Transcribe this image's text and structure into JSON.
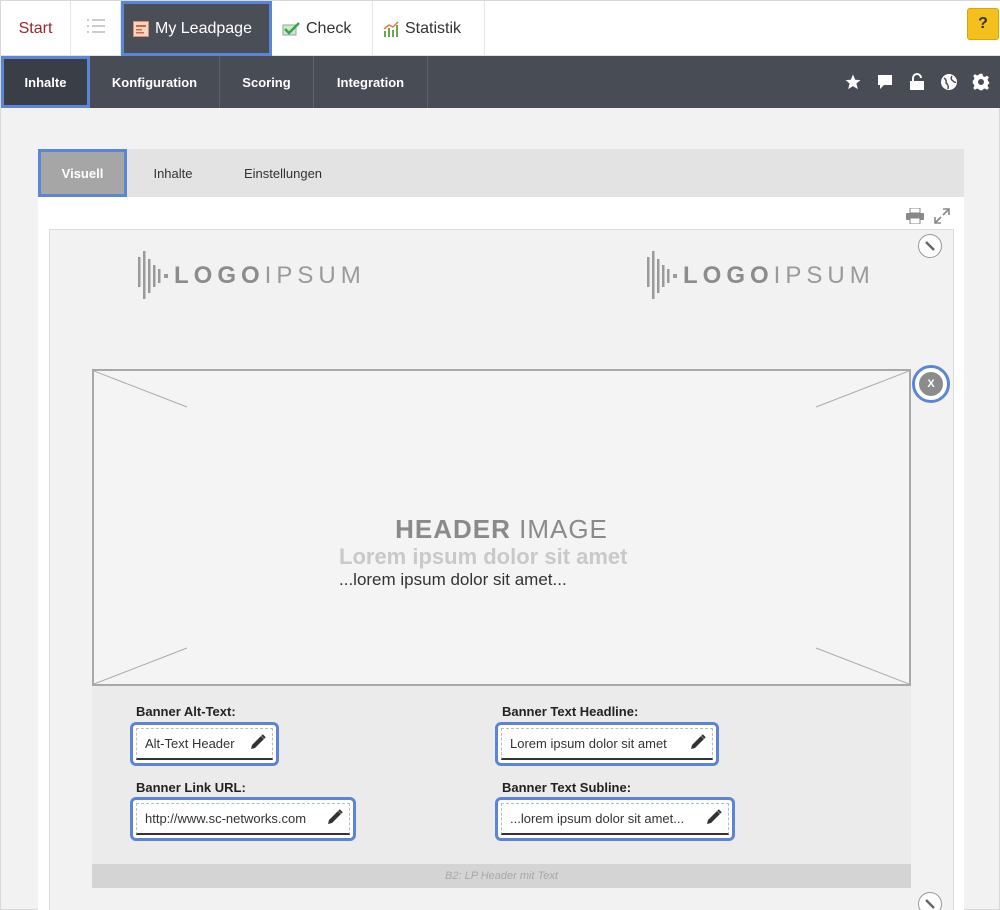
{
  "top_tabs": {
    "start": "Start",
    "leadpage": "My Leadpage",
    "check": "Check",
    "statistik": "Statistik",
    "help": "?"
  },
  "nav": {
    "items": [
      "Inhalte",
      "Konfiguration",
      "Scoring",
      "Integration"
    ],
    "icons": [
      "star-icon",
      "comment-icon",
      "unlock-icon",
      "globe-icon",
      "gear-icon"
    ]
  },
  "sub_tabs": [
    "Visuell",
    "Inhalte",
    "Einstellungen"
  ],
  "logos": {
    "left": {
      "bold": "LOGO",
      "light": "IPSUM"
    },
    "right": {
      "bold": "LOGO",
      "light": "IPSUM"
    }
  },
  "header_image": {
    "title_bold": "HEADER",
    "title_light": " IMAGE",
    "headline": "Lorem ipsum dolor sit amet",
    "subline": "...lorem ipsum dolor sit amet...",
    "close": "X"
  },
  "form": {
    "alt_text": {
      "label": "Banner Alt-Text:",
      "value": "Alt-Text Header"
    },
    "link_url": {
      "label": "Banner Link URL:",
      "value": "http://www.sc-networks.com"
    },
    "headline": {
      "label": "Banner Text Headline:",
      "value": "Lorem ipsum dolor sit amet"
    },
    "subline": {
      "label": "Banner Text Subline:",
      "value": "...lorem ipsum dolor sit amet..."
    }
  },
  "block_label": "B2: LP Header mit Text",
  "colors": {
    "accent": "#5b86d6",
    "dark_nav": "#484c55",
    "start_red": "#a0232b",
    "help_yellow": "#f4c01e"
  }
}
